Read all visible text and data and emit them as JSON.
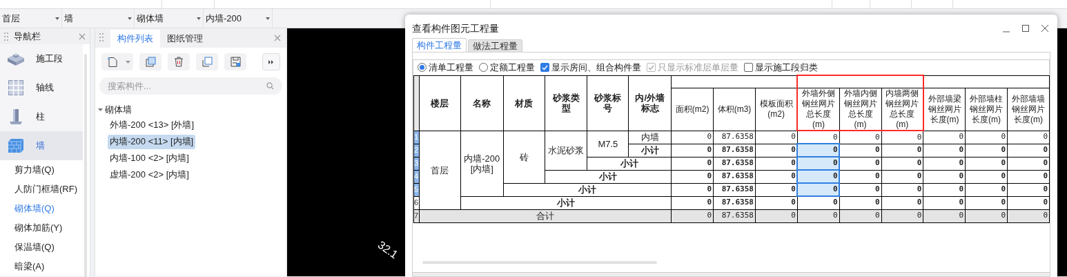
{
  "selectors": [
    {
      "value": "首层"
    },
    {
      "value": "墙"
    },
    {
      "value": "砌体墙"
    },
    {
      "value": "内墙-200"
    }
  ],
  "navigation": {
    "title": "导航栏",
    "items": [
      {
        "text": "施工段",
        "kind": "category",
        "selected": false
      },
      {
        "text": "轴线",
        "kind": "category",
        "selected": false
      },
      {
        "text": "柱",
        "kind": "category",
        "selected": false
      },
      {
        "text": "墙",
        "kind": "category",
        "selected": true
      },
      {
        "text": "剪力墙(Q)",
        "kind": "sub",
        "selected": false
      },
      {
        "text": "人防门框墙(RF)",
        "kind": "sub",
        "selected": false
      },
      {
        "text": "砌体墙(Q)",
        "kind": "sub",
        "selected": true
      },
      {
        "text": "砌体加筋(Y)",
        "kind": "sub",
        "selected": false
      },
      {
        "text": "保温墙(Q)",
        "kind": "sub",
        "selected": false
      },
      {
        "text": "暗梁(A)",
        "kind": "sub",
        "selected": false
      }
    ]
  },
  "component_panel": {
    "tabs": [
      {
        "label": "构件列表",
        "selected": true
      },
      {
        "label": "图纸管理",
        "selected": false
      }
    ],
    "search": {
      "placeholder": "搜索构件..."
    },
    "tree": [
      {
        "text": "砌体墙",
        "expanded": true,
        "children": [
          {
            "text": "外墙-200 <13> [外墙]",
            "selected": false
          },
          {
            "text": "内墙-200 <11> [内墙]",
            "selected": true
          },
          {
            "text": "内墙-100 <2> [内墙]",
            "selected": false
          },
          {
            "text": "虚墙-200 <2> [内墙]",
            "selected": false
          }
        ]
      }
    ]
  },
  "canvas": {
    "text": "32.1"
  },
  "dialog": {
    "title": "查看构件图元工程量",
    "tabs": [
      {
        "label": "构件工程量",
        "selected": true
      },
      {
        "label": "做法工程量",
        "selected": false
      }
    ],
    "options": [
      {
        "kind": "radio",
        "label": "清单工程量",
        "checked": true,
        "disabled": false
      },
      {
        "kind": "radio",
        "label": "定额工程量",
        "checked": false,
        "disabled": false
      },
      {
        "kind": "checkbox",
        "label": "显示房间、组合构件量",
        "checked": true,
        "disabled": false
      },
      {
        "kind": "checkbox",
        "label": "只显示标准层单层量",
        "checked": true,
        "disabled": true
      },
      {
        "kind": "checkbox",
        "label": "显示施工段归类",
        "checked": false,
        "disabled": false
      }
    ],
    "table": {
      "columns": [
        {
          "text": "楼层",
          "outlined": false
        },
        {
          "text": "名称",
          "outlined": false
        },
        {
          "text": "材质",
          "outlined": false
        },
        {
          "text": "砂浆类型",
          "outlined": false
        },
        {
          "text": "砂浆标号",
          "outlined": false
        },
        {
          "text": "内/外墙标志",
          "outlined": false
        },
        {
          "text": "面积(m2)",
          "outlined": false
        },
        {
          "text": "体积(m3)",
          "outlined": false
        },
        {
          "text": "模板面积(m2)",
          "outlined": false
        },
        {
          "text": "外墙外侧钢丝网片总长度(m)",
          "outlined": true
        },
        {
          "text": "外墙内侧钢丝网片总长度(m)",
          "outlined": true
        },
        {
          "text": "内墙两侧钢丝网片总长度(m)",
          "outlined": true
        },
        {
          "text": "外部墙梁钢丝网片长度(m)",
          "outlined": false
        },
        {
          "text": "外部墙柱钢丝网片长度(m)",
          "outlined": false
        },
        {
          "text": "外部墙墙钢丝网片长度(m)",
          "outlined": false
        }
      ],
      "body": [
        {
          "text": "首层",
          "children": [
            {
              "text": "内墙-200\n[内墙]",
              "children": [
                {
                  "text": "砖",
                  "children": [
                    {
                      "text": "水泥砂浆",
                      "children": [
                        {
                          "text": "M7.5",
                          "children": [
                            {
                              "text": "内墙",
                              "row_number": "1",
                              "selected": true,
                              "cells": [
                                {
                                  "text": "0",
                                  "selected": false
                                },
                                {
                                  "text": "87.6358",
                                  "selected": false
                                },
                                {
                                  "text": "0",
                                  "selected": false
                                },
                                {
                                  "text": "0",
                                  "selected": false
                                },
                                {
                                  "text": "0",
                                  "selected": false
                                },
                                {
                                  "text": "0",
                                  "selected": false
                                },
                                {
                                  "text": "0",
                                  "selected": false
                                },
                                {
                                  "text": "0",
                                  "selected": false
                                },
                                {
                                  "text": "0",
                                  "selected": false
                                }
                              ]
                            }
                          ],
                          "subtotal": {
                            "text": "小计",
                            "row_number": "2",
                            "selected": true,
                            "cells": [
                              {
                                "text": "0",
                                "selected": false
                              },
                              {
                                "text": "87.6358",
                                "selected": false
                              },
                              {
                                "text": "0",
                                "selected": false
                              },
                              {
                                "text": "0",
                                "selected": true
                              },
                              {
                                "text": "0",
                                "selected": false
                              },
                              {
                                "text": "0",
                                "selected": false
                              },
                              {
                                "text": "0",
                                "selected": false
                              },
                              {
                                "text": "0",
                                "selected": false
                              },
                              {
                                "text": "0",
                                "selected": false
                              }
                            ]
                          }
                        }
                      ],
                      "subtotal": {
                        "text": "小计",
                        "row_number": "3",
                        "selected": true,
                        "cells": [
                          {
                            "text": "0",
                            "selected": false
                          },
                          {
                            "text": "87.6358",
                            "selected": false
                          },
                          {
                            "text": "0",
                            "selected": false
                          },
                          {
                            "text": "0",
                            "selected": true
                          },
                          {
                            "text": "0",
                            "selected": false
                          },
                          {
                            "text": "0",
                            "selected": false
                          },
                          {
                            "text": "0",
                            "selected": false
                          },
                          {
                            "text": "0",
                            "selected": false
                          },
                          {
                            "text": "0",
                            "selected": false
                          }
                        ]
                      }
                    }
                  ],
                  "subtotal": {
                    "text": "小计",
                    "row_number": "4",
                    "selected": true,
                    "cells": [
                      {
                        "text": "0",
                        "selected": false
                      },
                      {
                        "text": "87.6358",
                        "selected": false
                      },
                      {
                        "text": "0",
                        "selected": false
                      },
                      {
                        "text": "0",
                        "selected": true
                      },
                      {
                        "text": "0",
                        "selected": false
                      },
                      {
                        "text": "0",
                        "selected": false
                      },
                      {
                        "text": "0",
                        "selected": false
                      },
                      {
                        "text": "0",
                        "selected": false
                      },
                      {
                        "text": "0",
                        "selected": false
                      }
                    ]
                  }
                }
              ],
              "subtotal": {
                "text": "小计",
                "row_number": "5",
                "selected": true,
                "cells": [
                  {
                    "text": "0",
                    "selected": false
                  },
                  {
                    "text": "87.6358",
                    "selected": false
                  },
                  {
                    "text": "0",
                    "selected": false
                  },
                  {
                    "text": "0",
                    "selected": true
                  },
                  {
                    "text": "0",
                    "selected": false
                  },
                  {
                    "text": "0",
                    "selected": false
                  },
                  {
                    "text": "0",
                    "selected": false
                  },
                  {
                    "text": "0",
                    "selected": false
                  },
                  {
                    "text": "0",
                    "selected": false
                  }
                ]
              }
            }
          ],
          "subtotal": {
            "text": "小计",
            "row_number": "6",
            "selected": false,
            "cells": [
              {
                "text": "0",
                "selected": false
              },
              {
                "text": "87.6358",
                "selected": false
              },
              {
                "text": "0",
                "selected": false
              },
              {
                "text": "0",
                "selected": false
              },
              {
                "text": "0",
                "selected": false
              },
              {
                "text": "0",
                "selected": false
              },
              {
                "text": "0",
                "selected": false
              },
              {
                "text": "0",
                "selected": false
              },
              {
                "text": "0",
                "selected": false
              }
            ]
          }
        }
      ],
      "total": {
        "text": "合计",
        "row_number": "7",
        "selected": false,
        "cells": [
          {
            "text": "0",
            "selected": false
          },
          {
            "text": "87.6358",
            "selected": false
          },
          {
            "text": "0",
            "selected": false
          },
          {
            "text": "0",
            "selected": false
          },
          {
            "text": "0",
            "selected": false
          },
          {
            "text": "0",
            "selected": false
          },
          {
            "text": "0",
            "selected": false
          },
          {
            "text": "0",
            "selected": false
          },
          {
            "text": "0",
            "selected": false
          }
        ]
      }
    }
  }
}
